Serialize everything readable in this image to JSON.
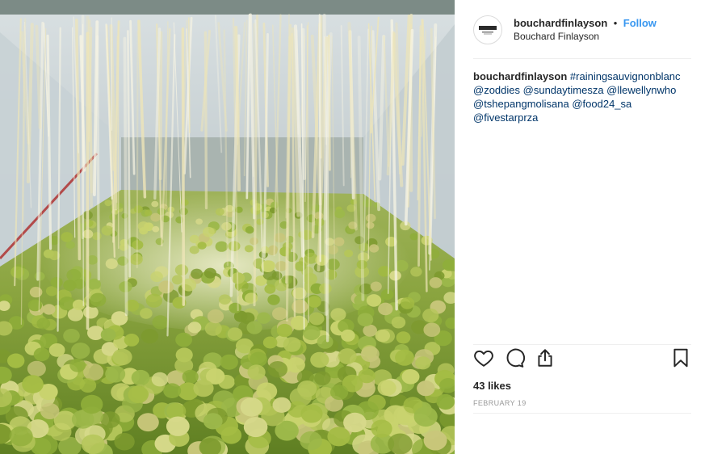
{
  "post": {
    "image_alt": "Sauvignon blanc grapes raining into a crusher bin"
  },
  "header": {
    "username": "bouchardfinlayson",
    "separator": "•",
    "follow_label": "Follow",
    "location": "Bouchard Finlayson"
  },
  "caption": {
    "username": "bouchardfinlayson",
    "tags": [
      "#rainingsauvignonblanc",
      "@zoddies",
      "@sundaytimesza",
      "@llewellynwho",
      "@tshepangmolisana",
      "@food24_sa",
      "@fivestarprza"
    ]
  },
  "actions": {
    "icons": [
      "heart-icon",
      "comment-icon",
      "share-icon",
      "bookmark-icon"
    ]
  },
  "likes": "43 likes",
  "date": "FEBRUARY 19",
  "colors": {
    "link": "#003569",
    "follow": "#3897f0",
    "text": "#262626",
    "muted": "#999999",
    "divider": "#efefef"
  }
}
